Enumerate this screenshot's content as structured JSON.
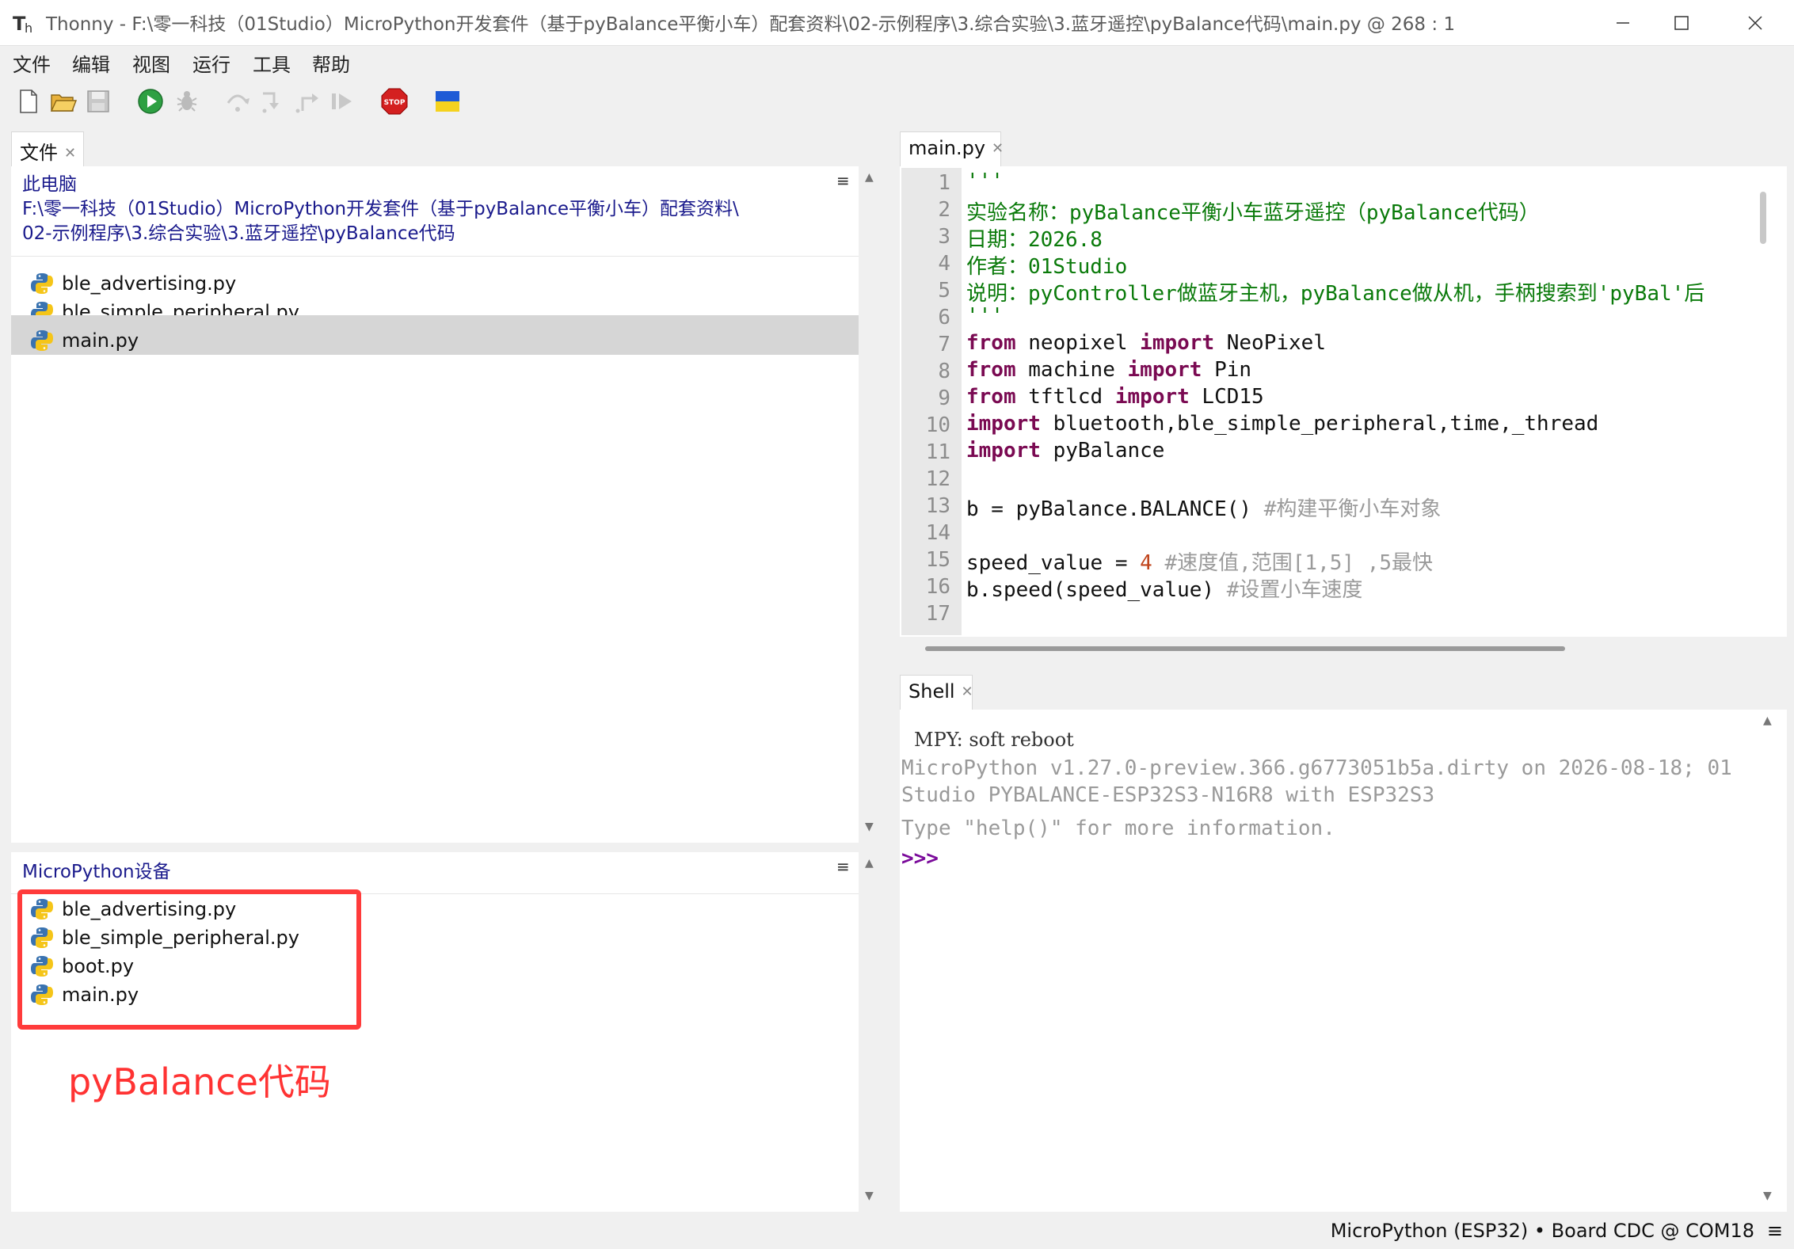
{
  "window": {
    "title": "Thonny  -  F:\\零一科技（01Studio）MicroPython开发套件（基于pyBalance平衡小车）配套资料\\02-示例程序\\3.综合实验\\3.蓝牙遥控\\pyBalance代码\\main.py  @  268 : 1"
  },
  "menu": [
    "文件",
    "编辑",
    "视图",
    "运行",
    "工具",
    "帮助"
  ],
  "toolbar": {
    "icons": [
      "new-file-icon",
      "open-file-icon",
      "save-icon",
      "run-icon",
      "debug-icon",
      "step-over-icon",
      "step-into-icon",
      "step-out-icon",
      "resume-icon",
      "stop-icon",
      "ukraine-flag-icon"
    ],
    "stop_label": "STOP"
  },
  "files_panel": {
    "tab": "文件",
    "this_pc": "此电脑",
    "path_line1": "F:\\零一科技（01Studio）MicroPython开发套件（基于pyBalance平衡小车）配套资料\\",
    "path_line2": "02-示例程序\\3.综合实验\\3.蓝牙遥控\\pyBalance代码",
    "local_files": [
      "ble_advertising.py",
      "ble_simple_peripheral.py",
      "main.py"
    ],
    "selected": "main.py",
    "device_header": "MicroPython设备",
    "device_files": [
      "ble_advertising.py",
      "ble_simple_peripheral.py",
      "boot.py",
      "main.py"
    ]
  },
  "annotation": {
    "label": "pyBalance代码",
    "color": "#ff3333"
  },
  "editor": {
    "tab": "main.py",
    "line_numbers": [
      "1",
      "2",
      "3",
      "4",
      "5",
      "6",
      "7",
      "8",
      "9",
      "10",
      "11",
      "12",
      "13",
      "14",
      "15",
      "16",
      "17"
    ],
    "lines": {
      "l1": "'''",
      "l2": "实验名称：pyBalance平衡小车蓝牙遥控（pyBalance代码）",
      "l3": "日期：2026.8",
      "l4": "作者：01Studio",
      "l5": "说明：pyController做蓝牙主机，pyBalance做从机，手柄搜索到'pyBal'后",
      "l6": "'''",
      "l7_kw1": "from",
      "l7_mid": " neopixel ",
      "l7_kw2": "import",
      "l7_end": " NeoPixel",
      "l8_kw1": "from",
      "l8_mid": " machine ",
      "l8_kw2": "import",
      "l8_end": " Pin",
      "l9_kw1": "from",
      "l9_mid": " tftlcd ",
      "l9_kw2": "import",
      "l9_end": " LCD15",
      "l10_kw": "import",
      "l10_end": " bluetooth,ble_simple_peripheral,time,_thread",
      "l11_kw": "import",
      "l11_end": " pyBalance",
      "l13_code": "b = pyBalance.BALANCE() ",
      "l13_cmt": "#构建平衡小车对象",
      "l15_code": "speed_value = ",
      "l15_num": "4",
      "l15_cmt": " #速度值,范围[1,5] ,5最快",
      "l16_code": "b.speed(speed_value) ",
      "l16_cmt": "#设置小车速度"
    }
  },
  "shell": {
    "tab": "Shell",
    "soft_reboot": "MPY: soft reboot",
    "banner1": "MicroPython v1.27.0-preview.366.g6773051b5a.dirty on 2026-08-18; 01",
    "banner2": "Studio PYBALANCE-ESP32S3-N16R8 with ESP32S3",
    "help": "Type \"help()\" for more information.",
    "prompt": ">>>"
  },
  "status_bar": {
    "text": "MicroPython (ESP32)  •  Board CDC @ COM18",
    "menu_icon": "≡"
  },
  "colors": {
    "keyword": "#7a0a52",
    "string": "#0a7a0a",
    "comment": "#9a9a9a",
    "number": "#c0451d",
    "path": "#1a1a8c",
    "selection": "#d6d6d6",
    "highlight_box": "#ff3b3b"
  }
}
